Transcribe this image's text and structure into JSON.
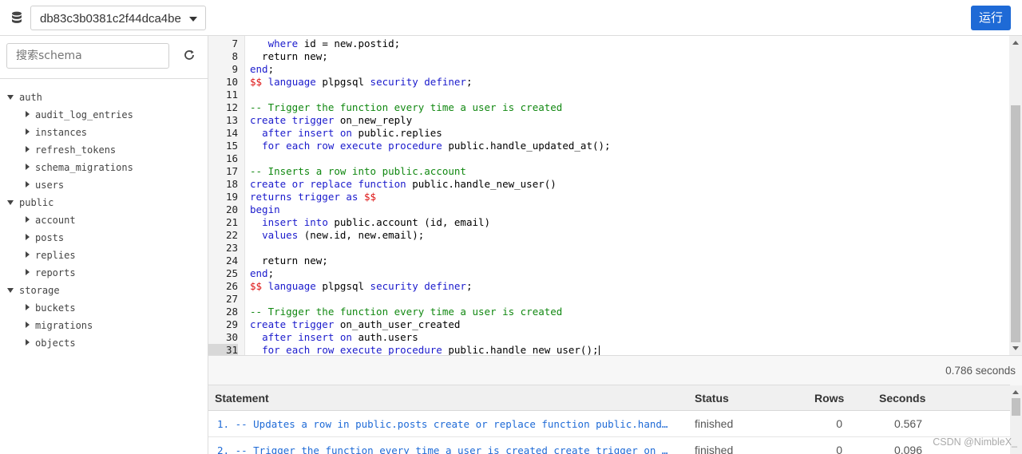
{
  "toolbar": {
    "database_id": "db83c3b0381c2f44dca4be",
    "run_label": "运行",
    "icons": {
      "database": "database-icon",
      "caret": "chevron-down-icon"
    }
  },
  "sidebar": {
    "search_placeholder": "搜索schema",
    "refresh_icon": "refresh-icon",
    "tree": [
      {
        "type": "schema",
        "label": "auth"
      },
      {
        "type": "table",
        "label": "audit_log_entries"
      },
      {
        "type": "table",
        "label": "instances"
      },
      {
        "type": "table",
        "label": "refresh_tokens"
      },
      {
        "type": "table",
        "label": "schema_migrations"
      },
      {
        "type": "table",
        "label": "users"
      },
      {
        "type": "schema",
        "label": "public"
      },
      {
        "type": "table",
        "label": "account"
      },
      {
        "type": "table",
        "label": "posts"
      },
      {
        "type": "table",
        "label": "replies"
      },
      {
        "type": "table",
        "label": "reports"
      },
      {
        "type": "schema",
        "label": "storage"
      },
      {
        "type": "table",
        "label": "buckets"
      },
      {
        "type": "table",
        "label": "migrations"
      },
      {
        "type": "table",
        "label": "objects"
      }
    ]
  },
  "editor": {
    "active_line": "31",
    "lines": [
      {
        "n": "7",
        "tokens": [
          [
            "",
            "   "
          ],
          [
            "kw",
            "where"
          ],
          [
            "",
            " id = new.postid;"
          ]
        ]
      },
      {
        "n": "8",
        "tokens": [
          [
            "",
            "  return new;"
          ]
        ]
      },
      {
        "n": "9",
        "tokens": [
          [
            "kw",
            "end"
          ],
          [
            "",
            ";"
          ]
        ]
      },
      {
        "n": "10",
        "tokens": [
          [
            "dl",
            "$$"
          ],
          [
            "",
            " "
          ],
          [
            "kw",
            "language"
          ],
          [
            "",
            " plpgsql "
          ],
          [
            "kw",
            "security definer"
          ],
          [
            "",
            ";"
          ]
        ]
      },
      {
        "n": "11",
        "tokens": []
      },
      {
        "n": "12",
        "tokens": [
          [
            "cm",
            "-- Trigger the function every time a user is created"
          ]
        ]
      },
      {
        "n": "13",
        "tokens": [
          [
            "kw",
            "create trigger"
          ],
          [
            "",
            " on_new_reply"
          ]
        ]
      },
      {
        "n": "14",
        "tokens": [
          [
            "",
            "  "
          ],
          [
            "kw",
            "after insert on"
          ],
          [
            "",
            " public.replies"
          ]
        ]
      },
      {
        "n": "15",
        "tokens": [
          [
            "",
            "  "
          ],
          [
            "kw",
            "for each row execute procedure"
          ],
          [
            "",
            " public.handle_updated_at();"
          ]
        ]
      },
      {
        "n": "16",
        "tokens": []
      },
      {
        "n": "17",
        "tokens": [
          [
            "cm",
            "-- Inserts a row into public.account"
          ]
        ]
      },
      {
        "n": "18",
        "tokens": [
          [
            "kw",
            "create or replace function"
          ],
          [
            "",
            " public.handle_new_user()"
          ]
        ]
      },
      {
        "n": "19",
        "tokens": [
          [
            "kw",
            "returns trigger as"
          ],
          [
            "",
            " "
          ],
          [
            "dl",
            "$$"
          ]
        ]
      },
      {
        "n": "20",
        "tokens": [
          [
            "kw",
            "begin"
          ]
        ]
      },
      {
        "n": "21",
        "tokens": [
          [
            "",
            "  "
          ],
          [
            "kw",
            "insert into"
          ],
          [
            "",
            " public.account (id, email)"
          ]
        ]
      },
      {
        "n": "22",
        "tokens": [
          [
            "",
            "  "
          ],
          [
            "kw",
            "values"
          ],
          [
            "",
            " (new.id, new.email);"
          ]
        ]
      },
      {
        "n": "23",
        "tokens": []
      },
      {
        "n": "24",
        "tokens": [
          [
            "",
            "  return new;"
          ]
        ]
      },
      {
        "n": "25",
        "tokens": [
          [
            "kw",
            "end"
          ],
          [
            "",
            ";"
          ]
        ]
      },
      {
        "n": "26",
        "tokens": [
          [
            "dl",
            "$$"
          ],
          [
            "",
            " "
          ],
          [
            "kw",
            "language"
          ],
          [
            "",
            " plpgsql "
          ],
          [
            "kw",
            "security definer"
          ],
          [
            "",
            ";"
          ]
        ]
      },
      {
        "n": "27",
        "tokens": []
      },
      {
        "n": "28",
        "tokens": [
          [
            "cm",
            "-- Trigger the function every time a user is created"
          ]
        ]
      },
      {
        "n": "29",
        "tokens": [
          [
            "kw",
            "create trigger"
          ],
          [
            "",
            " on_auth_user_created"
          ]
        ]
      },
      {
        "n": "30",
        "tokens": [
          [
            "",
            "  "
          ],
          [
            "kw",
            "after insert on"
          ],
          [
            "",
            " auth.users"
          ]
        ]
      },
      {
        "n": "31",
        "tokens": [
          [
            "",
            "  "
          ],
          [
            "kw",
            "for each row execute procedure"
          ],
          [
            "",
            " public.handle_new_user();"
          ]
        ]
      }
    ]
  },
  "results": {
    "elapsed": "0.786 seconds",
    "headers": {
      "statement": "Statement",
      "status": "Status",
      "rows": "Rows",
      "seconds": "Seconds"
    },
    "rows": [
      {
        "statement": "1. -- Updates a row in public.posts create or replace function public.hand…",
        "status": "finished",
        "rows": "0",
        "seconds": "0.567"
      },
      {
        "statement": "2. -- Trigger the function every time a user is created create trigger on …",
        "status": "finished",
        "rows": "0",
        "seconds": "0.096"
      }
    ]
  },
  "watermark": "CSDN @NimbleX_"
}
